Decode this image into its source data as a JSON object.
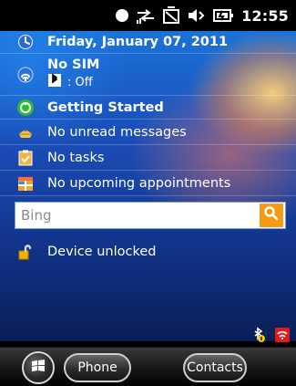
{
  "statusbar": {
    "time": "12:55"
  },
  "today": {
    "date": "Friday, January 07, 2011",
    "sim": {
      "title": "No SIM",
      "bluetooth_status": ": Off"
    },
    "getting_started": "Getting Started",
    "messages": "No unread messages",
    "tasks": "No tasks",
    "appointments": "No upcoming appointments",
    "search": {
      "placeholder": "Bing"
    },
    "lock": "Device unlocked"
  },
  "softkeys": {
    "left": "Phone",
    "right": "Contacts"
  },
  "colors": {
    "search_button": "#F59A13",
    "getting_started_icon": "#2EBB2E",
    "tray_signal_off": "#E21A1A"
  }
}
